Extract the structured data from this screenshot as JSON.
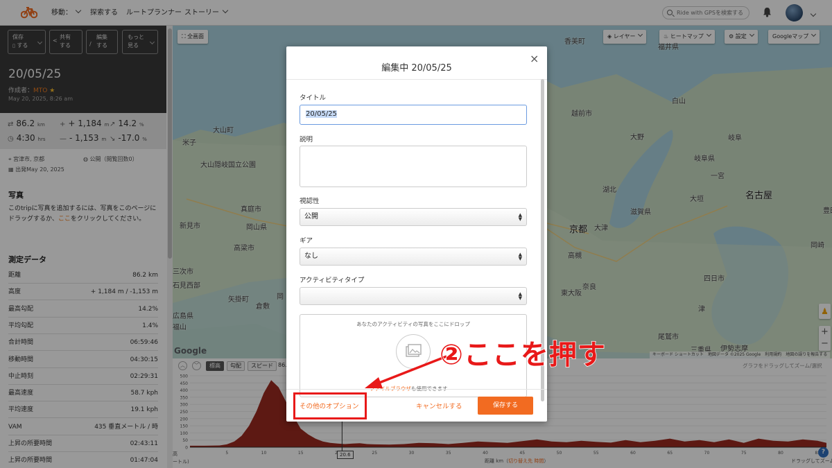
{
  "header": {
    "nav": [
      {
        "label": "移動：",
        "has_menu": true
      },
      {
        "label": "探索する",
        "has_menu": false
      },
      {
        "label": "ルートプランナー",
        "has_menu": false
      },
      {
        "label": "ストーリー",
        "has_menu": true
      }
    ],
    "search_placeholder": "Ride with GPSを検索する",
    "brand_color": "#f26b21"
  },
  "sidebar": {
    "actions": [
      {
        "icon": "bookmark-icon",
        "line1": "保存",
        "line2": "する"
      },
      {
        "icon": "share-icon",
        "line1": "共有",
        "line2": "する"
      },
      {
        "icon": "pencil-icon",
        "line1": "編集",
        "line2": "する"
      },
      {
        "icon": "",
        "line1": "もっと",
        "line2": "見る"
      }
    ],
    "title": "20/05/25",
    "author_label": "作成者：",
    "author": "MTO",
    "date": "May 20, 2025, 8:26 am",
    "stats": [
      {
        "icon": "distance-icon",
        "value": "86.2",
        "unit": "km"
      },
      {
        "icon": "plus-icon",
        "value": "+ 1,184",
        "unit": "m"
      },
      {
        "icon": "arrow-up-right-icon",
        "value": "14.2",
        "unit": "%"
      },
      {
        "icon": "clock-icon",
        "value": "4:30",
        "unit": "hrs"
      },
      {
        "icon": "minus-icon",
        "value": "- 1,153",
        "unit": "m"
      },
      {
        "icon": "arrow-down-right-icon",
        "value": "-17.0",
        "unit": "%"
      }
    ],
    "location": "宮津市, 京都",
    "visibility": "公開（閲覧回数0）",
    "departure": "出発May 20, 2025",
    "photos_heading": "写真",
    "photos_text_before": "このtripに写真を追加するには、写真をこのページにドラッグするか、",
    "photos_link": "ここ",
    "photos_text_after": "をクリックしてください。",
    "metrics_heading": "測定データ",
    "metrics": [
      {
        "label": "距離",
        "value": "86.2 km"
      },
      {
        "label": "高度",
        "value": "+ 1,184 m / -1,153 m"
      },
      {
        "label": "最高勾配",
        "value": "14.2%"
      },
      {
        "label": "平均勾配",
        "value": "1.4%"
      },
      {
        "label": "合計時間",
        "value": "06:59:46"
      },
      {
        "label": "移動時間",
        "value": "04:30:15"
      },
      {
        "label": "中止時刻",
        "value": "02:29:31"
      },
      {
        "label": "最高速度",
        "value": "58.7 kph"
      },
      {
        "label": "平均速度",
        "value": "19.1 kph"
      },
      {
        "label": "VAM",
        "value": "435 垂直メートル / 時"
      },
      {
        "label": "上昇の所要時間",
        "value": "02:43:11"
      },
      {
        "label": "上昇の所要時間",
        "value": "01:47:04"
      }
    ]
  },
  "map": {
    "fullscreen_label": "全画面",
    "controls": [
      {
        "icon": "layers-icon",
        "label": "レイヤー"
      },
      {
        "icon": "flame-icon",
        "label": "ヒートマップ"
      },
      {
        "icon": "gear-icon",
        "label": "設定"
      },
      {
        "icon": "",
        "label": "Googleマップ"
      }
    ],
    "places": [
      {
        "name": "京都",
        "major": true
      },
      {
        "name": "大津",
        "major": false
      },
      {
        "name": "名古屋",
        "major": true
      },
      {
        "name": "岐阜",
        "major": false
      },
      {
        "name": "福井県",
        "major": false
      },
      {
        "name": "岐阜県",
        "major": false
      },
      {
        "name": "滋賀県",
        "major": false
      },
      {
        "name": "奈良",
        "major": false
      },
      {
        "name": "高槻",
        "major": false
      },
      {
        "name": "東大阪",
        "major": false
      },
      {
        "name": "大垣",
        "major": false
      },
      {
        "name": "豊田",
        "major": false
      },
      {
        "name": "岡崎",
        "major": false
      },
      {
        "name": "三重県",
        "major": false
      },
      {
        "name": "伊勢志摩",
        "major": false
      },
      {
        "name": "岡山県",
        "major": false
      },
      {
        "name": "倉敷",
        "major": false
      },
      {
        "name": "福山",
        "major": false
      },
      {
        "name": "大山隠岐国立公園",
        "major": false
      },
      {
        "name": "米子",
        "major": false
      },
      {
        "name": "大山町",
        "major": false
      },
      {
        "name": "真庭市",
        "major": false
      },
      {
        "name": "高梁市",
        "major": false
      },
      {
        "name": "岡",
        "major": false
      },
      {
        "name": "新見市",
        "major": false
      },
      {
        "name": "石見西部",
        "major": false
      },
      {
        "name": "矢掛町",
        "major": false
      },
      {
        "name": "広島県",
        "major": false
      },
      {
        "name": "三次市",
        "major": false
      },
      {
        "name": "白山",
        "major": false
      },
      {
        "name": "大野",
        "major": false
      },
      {
        "name": "越前市",
        "major": false
      },
      {
        "name": "津",
        "major": false
      },
      {
        "name": "尾鷲市",
        "major": false
      },
      {
        "name": "一宮",
        "major": false
      },
      {
        "name": "四日市",
        "major": false
      },
      {
        "name": "香美町",
        "major": false
      },
      {
        "name": "湖北",
        "major": false
      }
    ],
    "attribution": [
      "キーボード ショートカット",
      "地図データ ©2025 Google",
      "利用規約",
      "地図の誤りを報告する"
    ],
    "google_logo": "Google",
    "zoom_in": "+",
    "zoom_out": "−"
  },
  "elevation": {
    "tabs": [
      {
        "label": "標高",
        "selected": true
      },
      {
        "label": "勾配",
        "selected": false
      },
      {
        "label": "スピード",
        "selected": false
      }
    ],
    "summary_fragment": "86.",
    "hint": "グラフをドラッグしてズーム/選択",
    "x_axis_label_parts": [
      "距離 km（",
      "切り替え先 時間",
      "）"
    ],
    "left_axis_fragment": "高",
    "left_axis_fragment2": "ートル)",
    "right_hint": "ドラッグしてズーム",
    "cursor_value": "20.6",
    "help_label": "?"
  },
  "chart_data": {
    "type": "area",
    "title": "",
    "xlabel": "距離 km",
    "ylabel": "",
    "xlim": [
      0,
      86.2
    ],
    "ylim": [
      0,
      500
    ],
    "y_ticks": [
      0,
      50,
      100,
      150,
      200,
      250,
      300,
      350,
      400,
      450,
      500
    ],
    "x_ticks": [
      5,
      10,
      15,
      20,
      25,
      30,
      35,
      40,
      45,
      50,
      55,
      60,
      65,
      70,
      75,
      80,
      85
    ],
    "color": "#9b2b20",
    "x": [
      0,
      2,
      4,
      5,
      6,
      7,
      8,
      9,
      10,
      11,
      12,
      13,
      14,
      15,
      16,
      17,
      18,
      19,
      20,
      21,
      22,
      23,
      24,
      25,
      27,
      29,
      31,
      33,
      35,
      37,
      39,
      41,
      43,
      45,
      47,
      49,
      51,
      53,
      55,
      57,
      59,
      61,
      63,
      65,
      67,
      69,
      71,
      73,
      75,
      77,
      79,
      81,
      83,
      85,
      86.2
    ],
    "y": [
      10,
      10,
      12,
      20,
      40,
      80,
      150,
      250,
      380,
      470,
      420,
      320,
      220,
      130,
      90,
      60,
      40,
      30,
      25,
      22,
      25,
      28,
      22,
      20,
      18,
      22,
      30,
      28,
      22,
      30,
      40,
      35,
      30,
      42,
      55,
      40,
      35,
      45,
      38,
      32,
      50,
      35,
      45,
      60,
      40,
      50,
      35,
      55,
      30,
      60,
      45,
      40,
      55,
      45,
      30
    ]
  },
  "modal": {
    "title": "編集中 20/05/25",
    "close_label": "×",
    "title_label": "タイトル",
    "title_value": "20/05/25",
    "description_label": "説明",
    "description_value": "",
    "visibility_label": "視認性",
    "visibility_value": "公開",
    "gear_label": "ギア",
    "gear_value": "なし",
    "activity_type_label": "アクティビティタイプ",
    "activity_type_value": "",
    "drop_text": "あなたのアクティビティの写真をここにドロップ",
    "drop_sub_link": "ファイルブラウザ",
    "drop_sub_rest": "も使用できます",
    "more_options": "その他のオプション",
    "cancel": "キャンセルする",
    "save": "保存する"
  },
  "annotation": {
    "text": "②ここを押す",
    "color": "#e81919"
  }
}
